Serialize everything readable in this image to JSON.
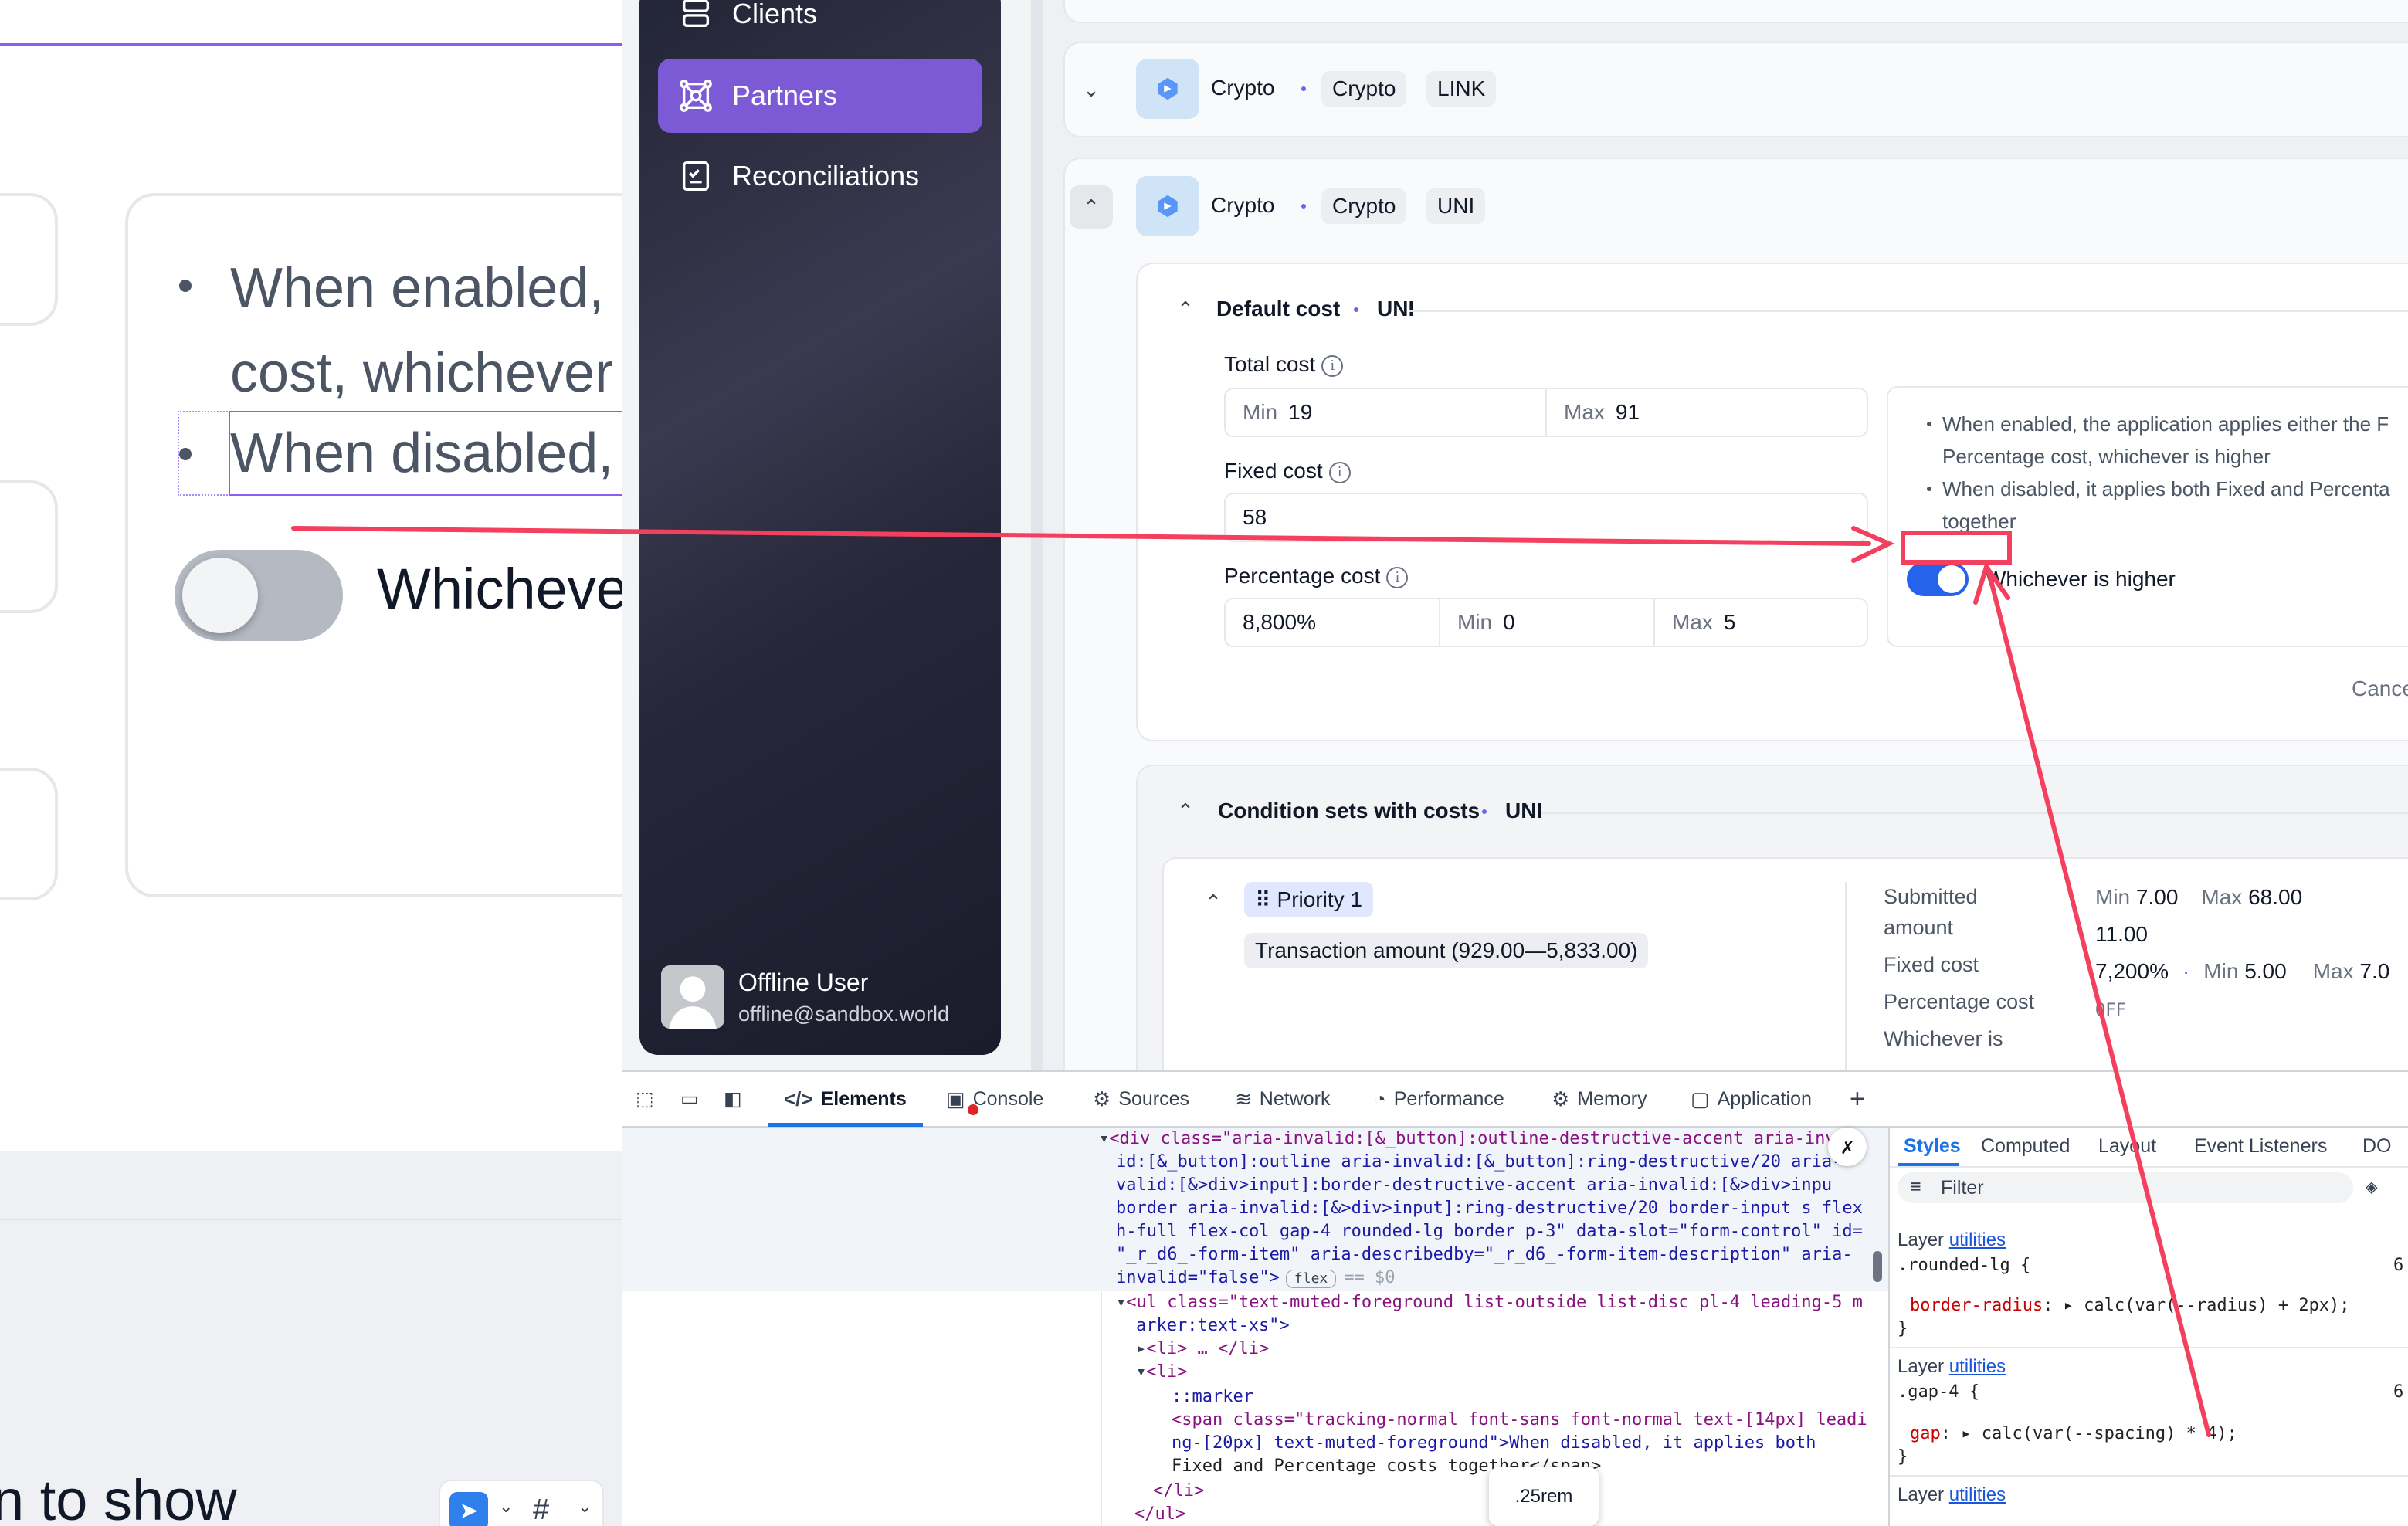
{
  "zoom_panel": {
    "bullet1_line1": "When enabled,",
    "bullet1_line2": "cost, whichever",
    "bullet2": "When disabled,",
    "toggle_label": "Whicheve",
    "bottom_text": "n to show"
  },
  "sidebar": {
    "items": [
      {
        "label": "Clients",
        "icon": "clients-icon"
      },
      {
        "label": "Partners",
        "icon": "partners-icon",
        "active": true
      },
      {
        "label": "Reconciliations",
        "icon": "reconciliations-icon"
      }
    ],
    "user": {
      "name": "Offline User",
      "email": "offline@sandbox.world"
    }
  },
  "partners": {
    "row_link": {
      "type": "Crypto",
      "category": "Crypto",
      "asset": "LINK"
    },
    "row_uni": {
      "type": "Crypto",
      "category": "Crypto",
      "asset": "UNI"
    }
  },
  "default_cost": {
    "title": "Default cost",
    "asset": "UNI",
    "total_cost_label": "Total cost",
    "total_min_label": "Min",
    "total_min": "19",
    "total_max_label": "Max",
    "total_max": "91",
    "fixed_cost_label": "Fixed cost",
    "fixed_cost": "58",
    "percentage_cost_label": "Percentage cost",
    "percentage_value": "8,800%",
    "pct_min_label": "Min",
    "pct_min": "0",
    "pct_max_label": "Max",
    "pct_max": "5",
    "hint_1a": "When enabled, the application applies either the F",
    "hint_1b": "Percentage cost, whichever is higher",
    "hint_2a": "When disabled, it applies both Fixed and Percenta",
    "hint_2b": "together",
    "toggle_label": "Whichever is higher",
    "toggle_on": true,
    "cancel_label": "Cance"
  },
  "condition_sets": {
    "title": "Condition sets with costs",
    "asset": "UNI",
    "priority_label": "Priority 1",
    "condition": "Transaction amount (929.00—5,833.00)",
    "submitted_amount_label_1": "Submitted",
    "submitted_amount_label_2": "amount",
    "fixed_cost_label": "Fixed cost",
    "percentage_cost_label": "Percentage cost",
    "whichever_label": "Whichever is",
    "min_label": "Min",
    "min_value": "7.00",
    "max_label": "Max",
    "max_value": "68.00",
    "fixed_value": "11.00",
    "pct_value": "7,200%",
    "pct_min_label": "Min",
    "pct_min": "5.00",
    "pct_max_label": "Max",
    "pct_max": "7.0",
    "whichever_value": "OFF"
  },
  "devtools": {
    "tabs": [
      {
        "label": "Elements",
        "icon": "code-icon",
        "active": true
      },
      {
        "label": "Console",
        "icon": "console-icon"
      },
      {
        "label": "Sources",
        "icon": "sources-icon"
      },
      {
        "label": "Network",
        "icon": "wifi-icon"
      },
      {
        "label": "Performance",
        "icon": "performance-icon"
      },
      {
        "label": "Memory",
        "icon": "memory-icon"
      },
      {
        "label": "Application",
        "icon": "application-icon"
      }
    ],
    "elements_lines": [
      "<div class=\"aria-invalid:[&_button]:outline-destructive-accent aria-inval",
      "id:[&_button]:outline aria-invalid:[&_button]:ring-destructive/20 aria-",
      "valid:[&>div>input]:border-destructive-accent aria-invalid:[&>div>inpu",
      "border aria-invalid:[&>div>input]:ring-destructive/20 border-input s flex",
      "h-full flex-col gap-4 rounded-lg border p-3\" data-slot=\"form-control\" id=",
      "\"_r_d6_-form-item\" aria-describedby=\"_r_d6_-form-item-description\" aria-",
      "invalid=\"false\">",
      "<ul class=\"text-muted-foreground list-outside list-disc pl-4 leading-5 m",
      "arker:text-xs\">",
      "<li> … </li>",
      "<li>",
      "::marker",
      "<span class=\"tracking-normal font-sans font-normal text-[14px] leadi",
      "ng-[20px] text-muted-foreground\">When disabled, it applies both",
      "Fixed and Percentage costs together</span>",
      "</li>",
      "</ul>"
    ],
    "flex_badge": "flex",
    "dollar_zero": "== $0",
    "styles_tabs": [
      "Styles",
      "Computed",
      "Layout",
      "Event Listeners",
      "DO"
    ],
    "filter_placeholder": "Filter",
    "rules": [
      {
        "layer": "Layer",
        "layer_link": "utilities",
        "selector": ".rounded-lg {",
        "prop": "border-radius",
        "value": "calc(var(--radius) + 2px);",
        "num": "6"
      },
      {
        "layer": "Layer",
        "layer_link": "utilities",
        "selector": ".gap-4 {",
        "prop": "gap",
        "value": "calc(var(--spacing) * 4);",
        "num": "6"
      },
      {
        "layer": "Layer",
        "layer_link": "utilities"
      }
    ],
    "tooltip": ".25rem"
  },
  "colors": {
    "accent": "#7c5ad6",
    "annotation": "#f43f5e",
    "toggle_on": "#2563eb",
    "devtools_blue": "#1a73e8"
  }
}
